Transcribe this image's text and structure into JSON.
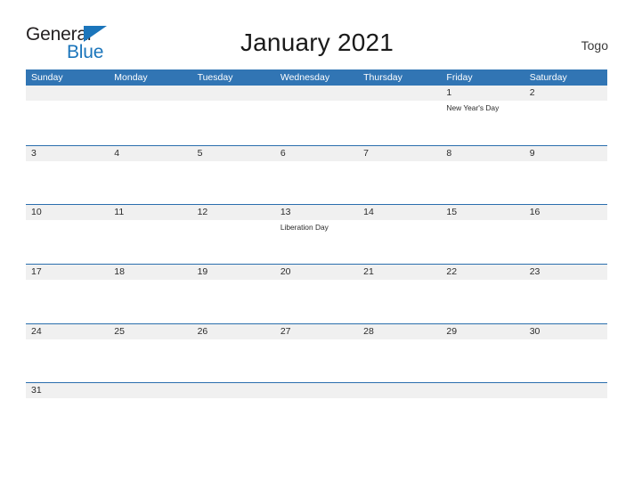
{
  "brand": {
    "word_one": "General",
    "word_two": "Blue",
    "flag_icon": "blue-triangle-flag",
    "accent_color": "#1b75bb"
  },
  "header": {
    "title": "January 2021",
    "country": "Togo"
  },
  "calendar": {
    "header_bg": "#3175b4",
    "row_border": "#2a6ead",
    "number_band_bg": "#f0f0f0",
    "weekday_headers": [
      "Sunday",
      "Monday",
      "Tuesday",
      "Wednesday",
      "Thursday",
      "Friday",
      "Saturday"
    ],
    "weeks": [
      [
        {
          "day": "",
          "event": ""
        },
        {
          "day": "",
          "event": ""
        },
        {
          "day": "",
          "event": ""
        },
        {
          "day": "",
          "event": ""
        },
        {
          "day": "",
          "event": ""
        },
        {
          "day": "1",
          "event": "New Year's Day"
        },
        {
          "day": "2",
          "event": ""
        }
      ],
      [
        {
          "day": "3",
          "event": ""
        },
        {
          "day": "4",
          "event": ""
        },
        {
          "day": "5",
          "event": ""
        },
        {
          "day": "6",
          "event": ""
        },
        {
          "day": "7",
          "event": ""
        },
        {
          "day": "8",
          "event": ""
        },
        {
          "day": "9",
          "event": ""
        }
      ],
      [
        {
          "day": "10",
          "event": ""
        },
        {
          "day": "11",
          "event": ""
        },
        {
          "day": "12",
          "event": ""
        },
        {
          "day": "13",
          "event": "Liberation Day"
        },
        {
          "day": "14",
          "event": ""
        },
        {
          "day": "15",
          "event": ""
        },
        {
          "day": "16",
          "event": ""
        }
      ],
      [
        {
          "day": "17",
          "event": ""
        },
        {
          "day": "18",
          "event": ""
        },
        {
          "day": "19",
          "event": ""
        },
        {
          "day": "20",
          "event": ""
        },
        {
          "day": "21",
          "event": ""
        },
        {
          "day": "22",
          "event": ""
        },
        {
          "day": "23",
          "event": ""
        }
      ],
      [
        {
          "day": "24",
          "event": ""
        },
        {
          "day": "25",
          "event": ""
        },
        {
          "day": "26",
          "event": ""
        },
        {
          "day": "27",
          "event": ""
        },
        {
          "day": "28",
          "event": ""
        },
        {
          "day": "29",
          "event": ""
        },
        {
          "day": "30",
          "event": ""
        }
      ],
      [
        {
          "day": "31",
          "event": ""
        },
        {
          "day": "",
          "event": ""
        },
        {
          "day": "",
          "event": ""
        },
        {
          "day": "",
          "event": ""
        },
        {
          "day": "",
          "event": ""
        },
        {
          "day": "",
          "event": ""
        },
        {
          "day": "",
          "event": ""
        }
      ]
    ]
  }
}
